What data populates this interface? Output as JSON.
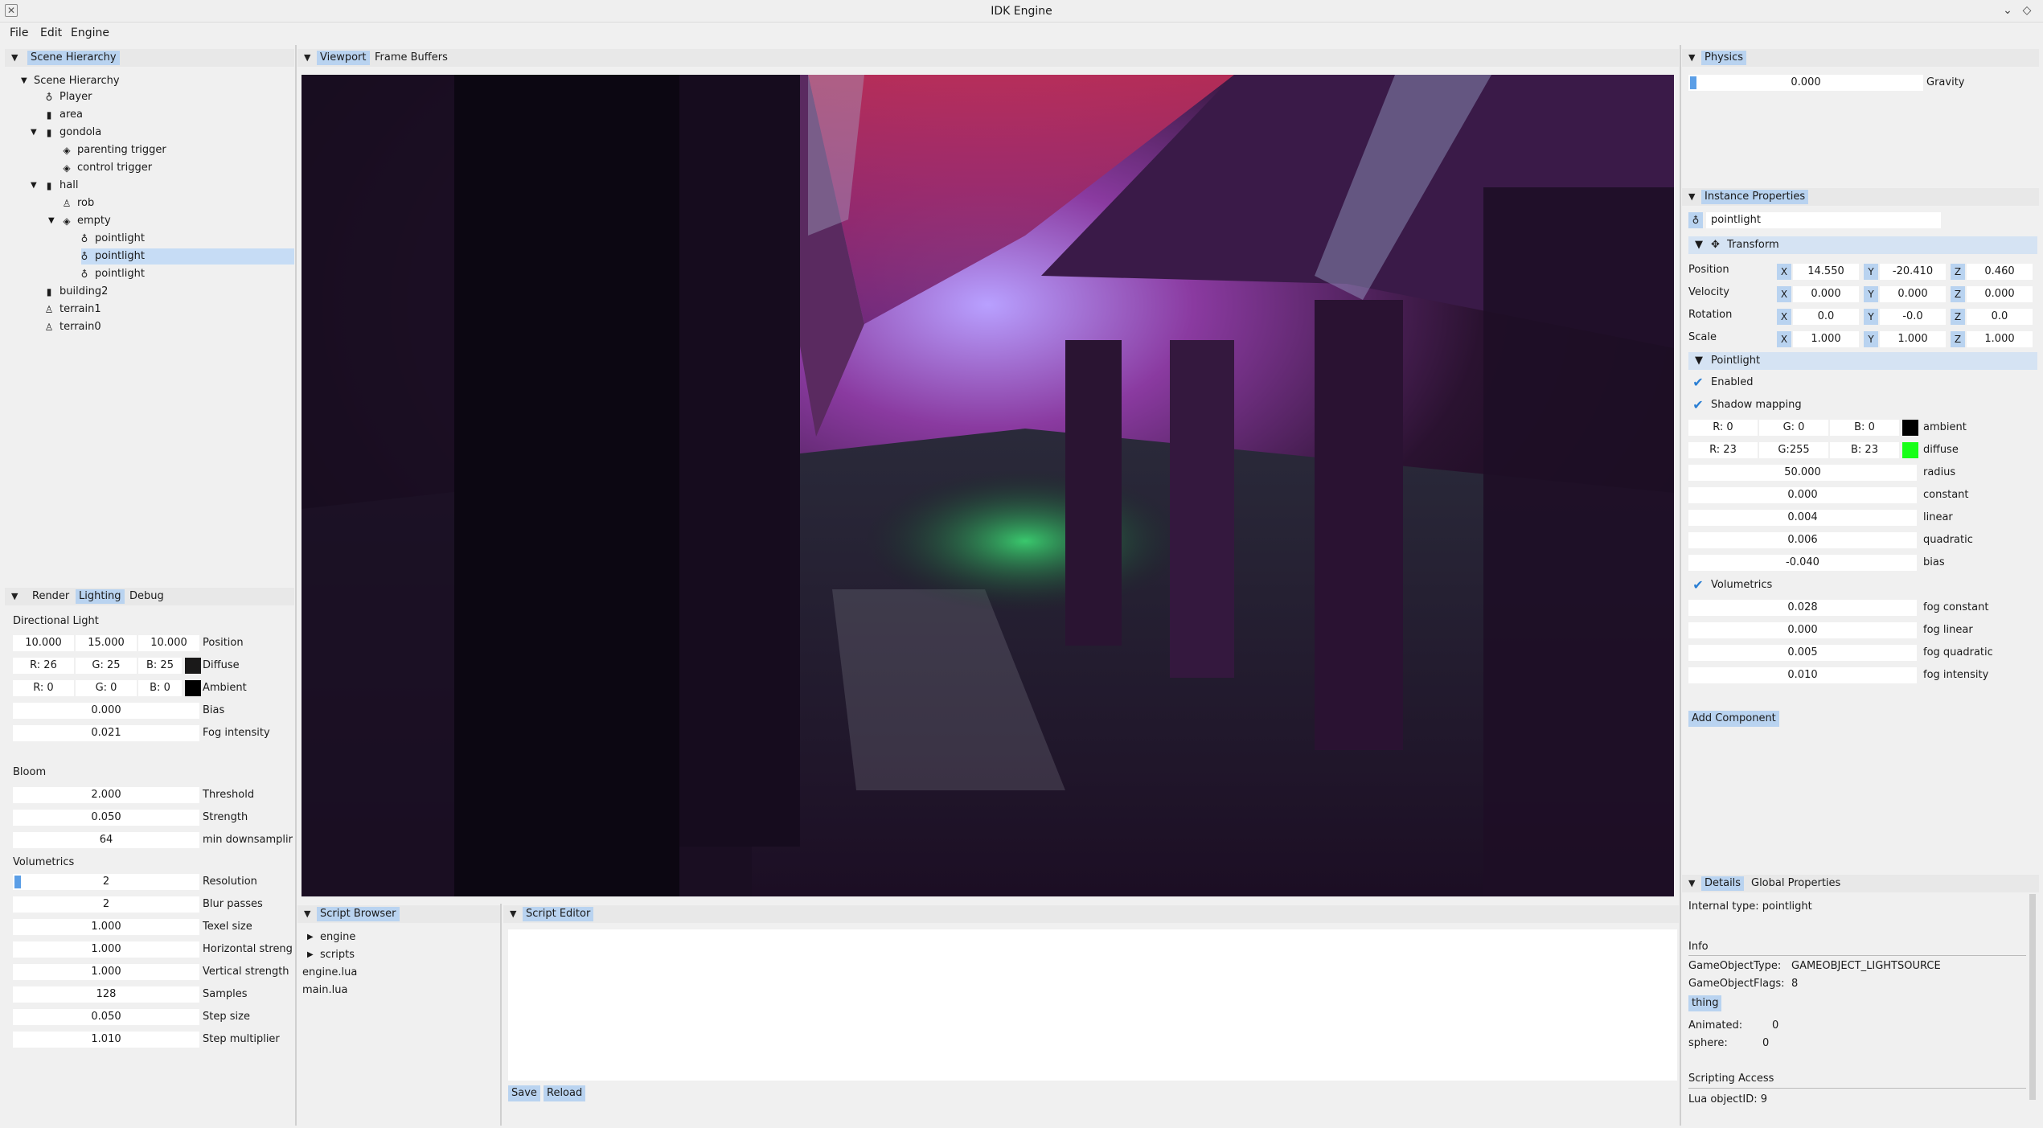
{
  "window": {
    "title": "IDK Engine"
  },
  "menu": [
    "File",
    "Edit",
    "Engine"
  ],
  "hierarchy": {
    "tab": "Scene Hierarchy",
    "root": "Scene Hierarchy",
    "items": [
      {
        "label": "Player",
        "icon": "lightbulb-icon",
        "depth": 1,
        "arrow": ""
      },
      {
        "label": "area",
        "icon": "building-icon",
        "depth": 1,
        "arrow": ""
      },
      {
        "label": "gondola",
        "icon": "building-icon",
        "depth": 1,
        "arrow": "▼"
      },
      {
        "label": "parenting trigger",
        "icon": "cube-icon",
        "depth": 2,
        "arrow": ""
      },
      {
        "label": "control trigger",
        "icon": "cube-icon",
        "depth": 2,
        "arrow": ""
      },
      {
        "label": "hall",
        "icon": "building-icon",
        "depth": 1,
        "arrow": "▼"
      },
      {
        "label": "rob",
        "icon": "person-icon",
        "depth": 2,
        "arrow": ""
      },
      {
        "label": "empty",
        "icon": "cube-icon",
        "depth": 2,
        "arrow": "▼"
      },
      {
        "label": "pointlight",
        "icon": "lightbulb-icon",
        "depth": 3,
        "arrow": ""
      },
      {
        "label": "pointlight",
        "icon": "lightbulb-icon",
        "depth": 3,
        "arrow": "",
        "selected": true
      },
      {
        "label": "pointlight",
        "icon": "lightbulb-icon",
        "depth": 3,
        "arrow": ""
      },
      {
        "label": "building2",
        "icon": "building-icon",
        "depth": 1,
        "arrow": ""
      },
      {
        "label": "terrain1",
        "icon": "person-icon",
        "depth": 1,
        "arrow": ""
      },
      {
        "label": "terrain0",
        "icon": "person-icon",
        "depth": 1,
        "arrow": ""
      }
    ]
  },
  "render": {
    "tabs": [
      "Render",
      "Lighting",
      "Debug"
    ],
    "active_tab": "Lighting",
    "dir_light_title": "Directional Light",
    "position": [
      "10.000",
      "15.000",
      "10.000"
    ],
    "position_label": "Position",
    "diffuse": [
      "R: 26",
      "G: 25",
      "B: 25"
    ],
    "diffuse_label": "Diffuse",
    "diffuse_color": "#1a1919",
    "ambient": [
      "R: 0",
      "G: 0",
      "B: 0"
    ],
    "ambient_label": "Ambient",
    "ambient_color": "#000000",
    "bias": "0.000",
    "bias_label": "Bias",
    "fog": "0.021",
    "fog_label": "Fog intensity",
    "bloom_title": "Bloom",
    "threshold": "2.000",
    "threshold_label": "Threshold",
    "strength": "0.050",
    "strength_label": "Strength",
    "min_down": "64",
    "min_down_label": "min downsamplir",
    "vol_title": "Volumetrics",
    "vol_rows": [
      {
        "value": "2",
        "label": "Resolution"
      },
      {
        "value": "2",
        "label": "Blur passes"
      },
      {
        "value": "1.000",
        "label": "Texel size"
      },
      {
        "value": "1.000",
        "label": "Horizontal streng"
      },
      {
        "value": "1.000",
        "label": "Vertical strength"
      },
      {
        "value": "128",
        "label": "Samples"
      },
      {
        "value": "0.050",
        "label": "Step size"
      },
      {
        "value": "1.010",
        "label": "Step multiplier"
      }
    ]
  },
  "viewport": {
    "tabs": [
      "Viewport",
      "Frame Buffers"
    ],
    "active_tab": "Viewport"
  },
  "script_browser": {
    "tab": "Script Browser",
    "folders": [
      "engine",
      "scripts"
    ],
    "files": [
      "engine.lua",
      "main.lua"
    ]
  },
  "script_editor": {
    "tab": "Script Editor",
    "save": "Save",
    "reload": "Reload"
  },
  "physics": {
    "tab": "Physics",
    "gravity": "0.000",
    "gravity_label": "Gravity"
  },
  "instance": {
    "tab": "Instance Properties",
    "name": "pointlight",
    "transform_title": "Transform",
    "rows": [
      {
        "label": "Position",
        "x": "14.550",
        "y": "-20.410",
        "z": "0.460"
      },
      {
        "label": "Velocity",
        "x": "0.000",
        "y": "0.000",
        "z": "0.000"
      },
      {
        "label": "Rotation",
        "x": "0.0",
        "y": "-0.0",
        "z": "0.0"
      },
      {
        "label": "Scale",
        "x": "1.000",
        "y": "1.000",
        "z": "1.000"
      }
    ],
    "axes": [
      "X",
      "Y",
      "Z"
    ],
    "pointlight_title": "Pointlight",
    "enabled": "Enabled",
    "shadow": "Shadow mapping",
    "ambient": [
      "R: 0",
      "G: 0",
      "B: 0"
    ],
    "ambient_label": "ambient",
    "ambient_color": "#000000",
    "diffuse": [
      "R: 23",
      "G:255",
      "B: 23"
    ],
    "diffuse_label": "diffuse",
    "diffuse_color": "#17ff17",
    "params": [
      {
        "value": "50.000",
        "label": "radius"
      },
      {
        "value": "0.000",
        "label": "constant"
      },
      {
        "value": "0.004",
        "label": "linear"
      },
      {
        "value": "0.006",
        "label": "quadratic"
      },
      {
        "value": "-0.040",
        "label": "bias"
      }
    ],
    "volumetrics": "Volumetrics",
    "fog": [
      {
        "value": "0.028",
        "label": "fog constant"
      },
      {
        "value": "0.000",
        "label": "fog linear"
      },
      {
        "value": "0.005",
        "label": "fog quadratic"
      },
      {
        "value": "0.010",
        "label": "fog intensity"
      }
    ],
    "add_component": "Add Component"
  },
  "details": {
    "tabs": [
      "Details",
      "Global Properties"
    ],
    "active_tab": "Details",
    "internal_type": "Internal type: pointlight",
    "info": "Info",
    "type_label": "GameObjectType:",
    "type_value": "GAMEOBJECT_LIGHTSOURCE",
    "flags_label": "GameObjectFlags:",
    "flags_value": "8",
    "thing": "thing",
    "animated_label": "Animated:",
    "animated_value": "0",
    "sphere_label": "sphere:",
    "sphere_value": "0",
    "scripting": "Scripting Access",
    "lua_id": "Lua objectID: 9"
  }
}
